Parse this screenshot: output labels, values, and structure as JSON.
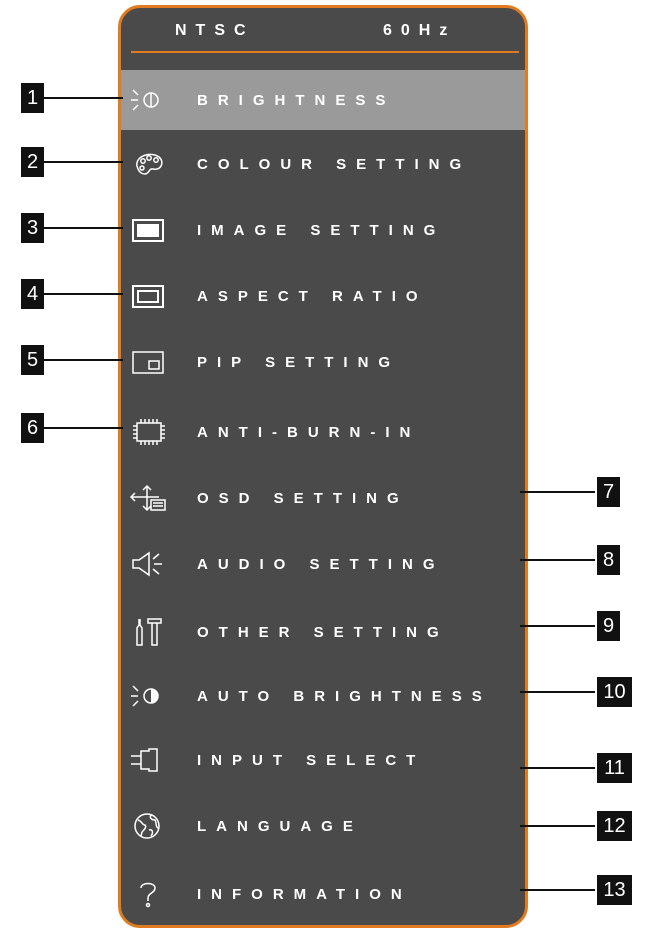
{
  "header": {
    "signal": "NTSC",
    "frequency": "60Hz"
  },
  "menu": [
    {
      "label": "BRIGHTNESS",
      "icon": "brightness-icon",
      "callout": "1",
      "selected": true
    },
    {
      "label": "COLOUR SETTING",
      "icon": "palette-icon",
      "callout": "2"
    },
    {
      "label": "IMAGE SETTING",
      "icon": "image-icon",
      "callout": "3"
    },
    {
      "label": "ASPECT RATIO",
      "icon": "aspect-ratio-icon",
      "callout": "4"
    },
    {
      "label": "PIP SETTING",
      "icon": "pip-icon",
      "callout": "5"
    },
    {
      "label": "ANTI-BURN-IN",
      "icon": "chip-icon",
      "callout": "6"
    },
    {
      "label": "OSD SETTING",
      "icon": "osd-move-icon",
      "callout": "7"
    },
    {
      "label": "AUDIO SETTING",
      "icon": "speaker-icon",
      "callout": "8"
    },
    {
      "label": "OTHER SETTING",
      "icon": "tools-icon",
      "callout": "9"
    },
    {
      "label": "AUTO BRIGHTNESS",
      "icon": "auto-brightness-icon",
      "callout": "10"
    },
    {
      "label": "INPUT SELECT",
      "icon": "input-connector-icon",
      "callout": "11"
    },
    {
      "label": "LANGUAGE",
      "icon": "globe-icon",
      "callout": "12"
    },
    {
      "label": "INFORMATION",
      "icon": "question-mark-icon",
      "callout": "13"
    }
  ],
  "colors": {
    "panel": "#4a4a4a",
    "border": "#e07b1f",
    "selected": "#9a9a9a"
  }
}
